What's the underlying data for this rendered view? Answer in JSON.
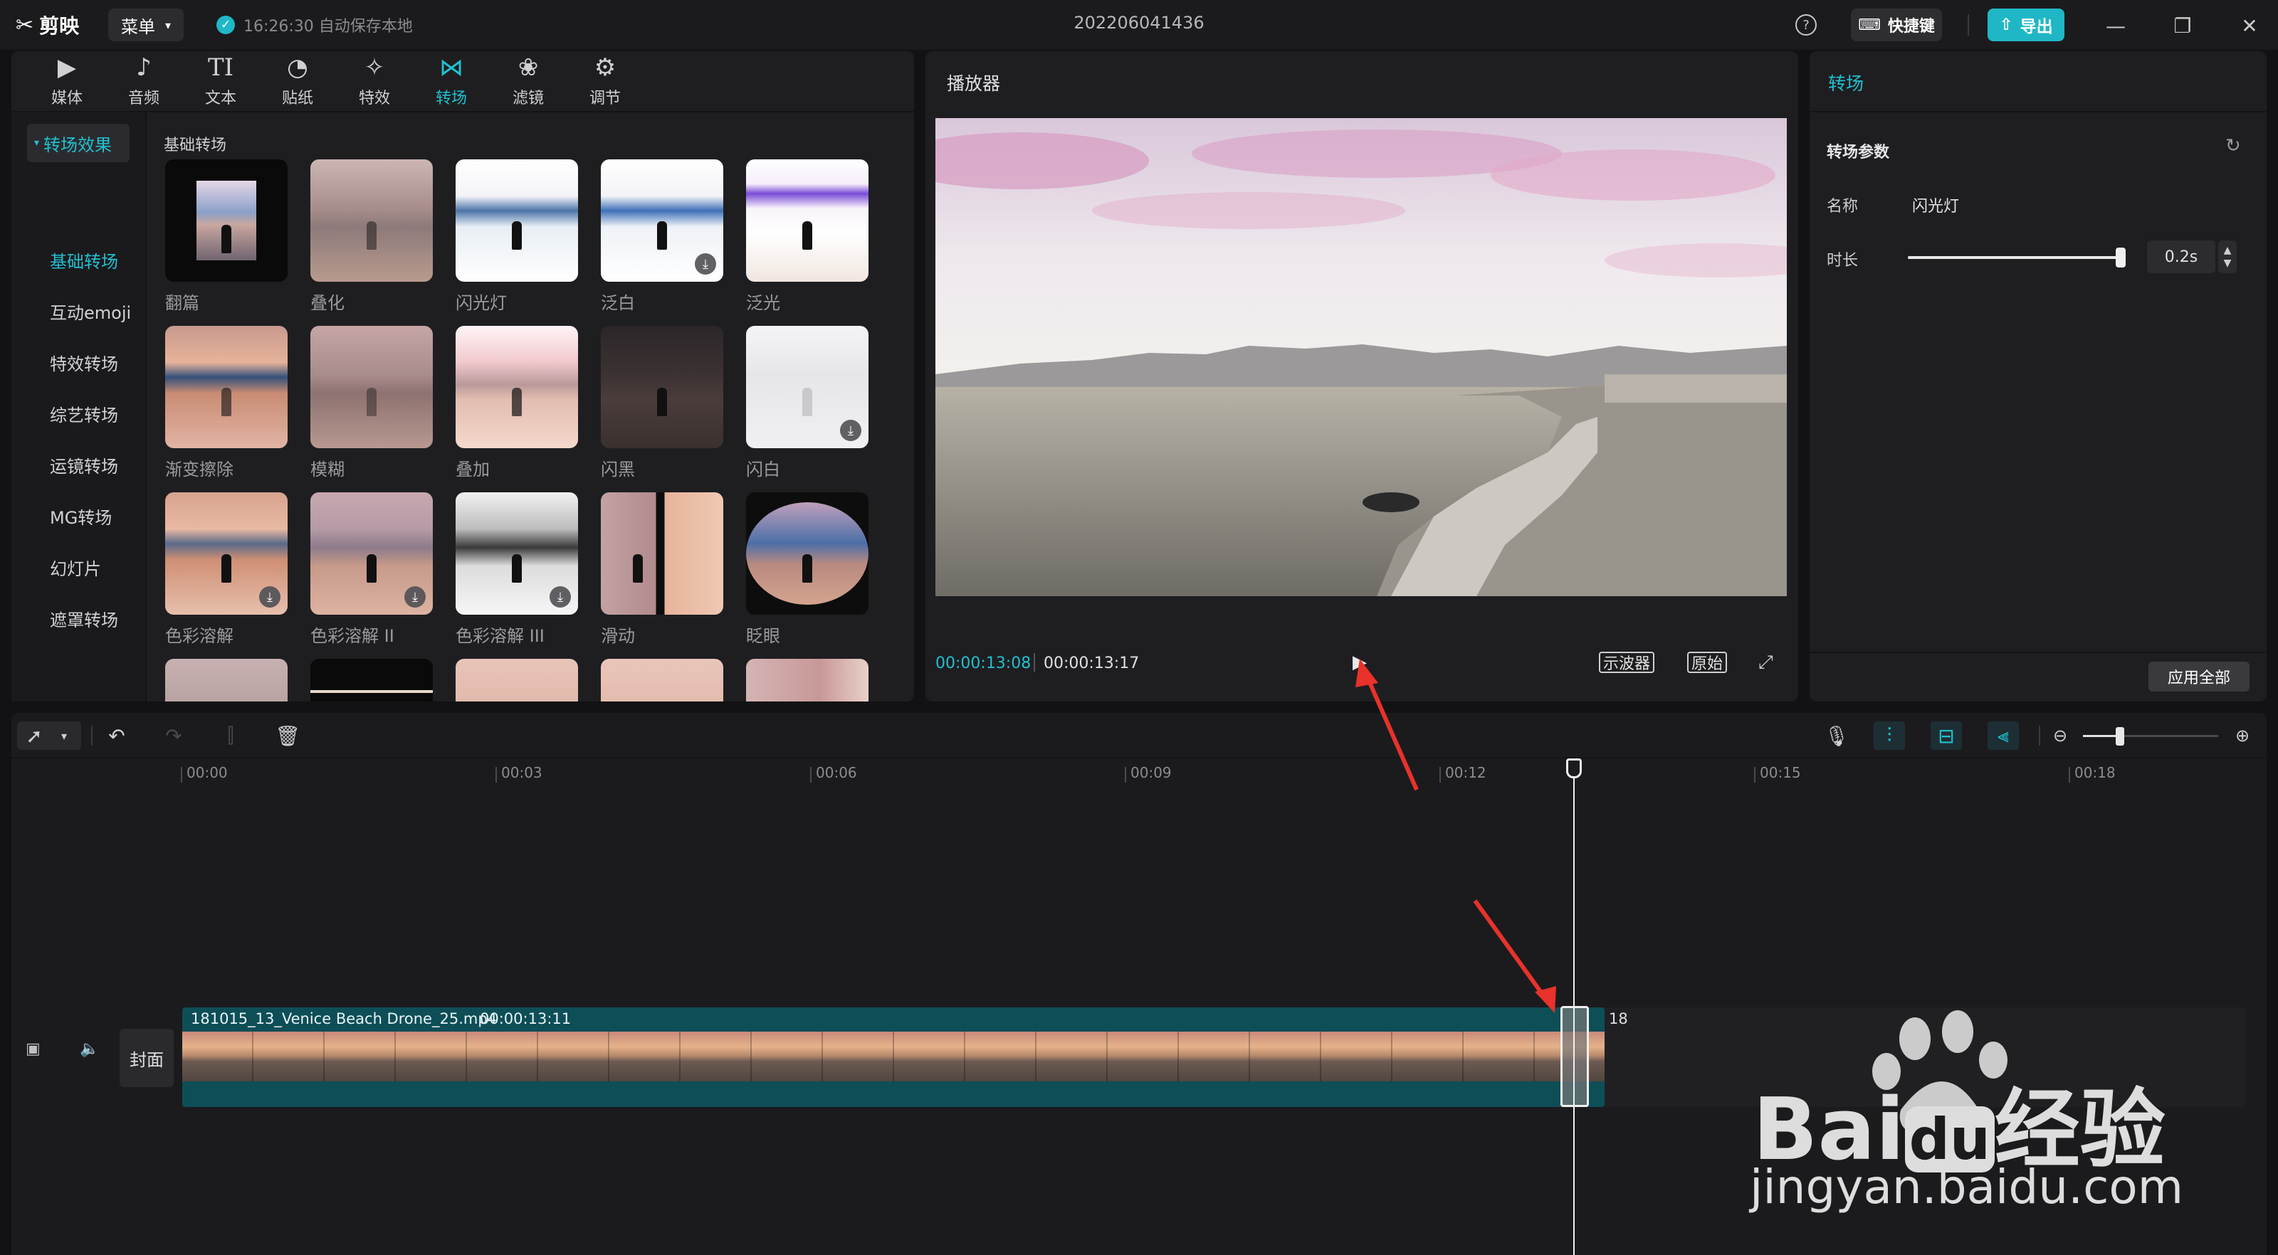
{
  "app": {
    "logo_text": "剪映",
    "menu_label": "菜单",
    "save_status": "16:26:30 自动保存本地",
    "document_title": "202206041436",
    "shortcut_label": "快捷键",
    "export_label": "导出"
  },
  "tabs": [
    {
      "label": "媒体",
      "icon": "media-icon"
    },
    {
      "label": "音频",
      "icon": "audio-icon"
    },
    {
      "label": "文本",
      "icon": "text-icon"
    },
    {
      "label": "贴纸",
      "icon": "sticker-icon"
    },
    {
      "label": "特效",
      "icon": "effects-icon"
    },
    {
      "label": "转场",
      "icon": "transition-icon",
      "active": true
    },
    {
      "label": "滤镜",
      "icon": "filter-icon"
    },
    {
      "label": "调节",
      "icon": "adjust-icon"
    }
  ],
  "sidebar": {
    "header": "转场效果",
    "items": [
      "基础转场",
      "互动emoji",
      "特效转场",
      "综艺转场",
      "运镜转场",
      "MG转场",
      "幻灯片",
      "遮罩转场"
    ]
  },
  "library": {
    "section_title": "基础转场",
    "items": [
      "翻篇",
      "叠化",
      "闪光灯",
      "泛白",
      "泛光",
      "渐变擦除",
      "模糊",
      "叠加",
      "闪黑",
      "闪白",
      "色彩溶解",
      "色彩溶解 II",
      "色彩溶解 III",
      "滑动",
      "眨眼"
    ]
  },
  "player": {
    "title": "播放器",
    "current_time": "00:00:13:08",
    "total_time": "00:00:13:17",
    "scope_label": "示波器",
    "original_label": "原始"
  },
  "inspector": {
    "title": "转场",
    "params_title": "转场参数",
    "name_label": "名称",
    "name_value": "闪光灯",
    "duration_label": "时长",
    "duration_value": "0.2s",
    "apply_all_label": "应用全部"
  },
  "timeline": {
    "ruler_labels": [
      "00:00",
      "00:03",
      "00:06",
      "00:09",
      "00:12",
      "00:15",
      "00:18"
    ],
    "cover_label": "封面",
    "clip_name": "181015_13_Venice Beach Drone_25.mp4",
    "clip_duration": "00:00:13:11",
    "clip2_label": "18"
  },
  "watermark": "Baidu经验 jingyan.baidu.com"
}
